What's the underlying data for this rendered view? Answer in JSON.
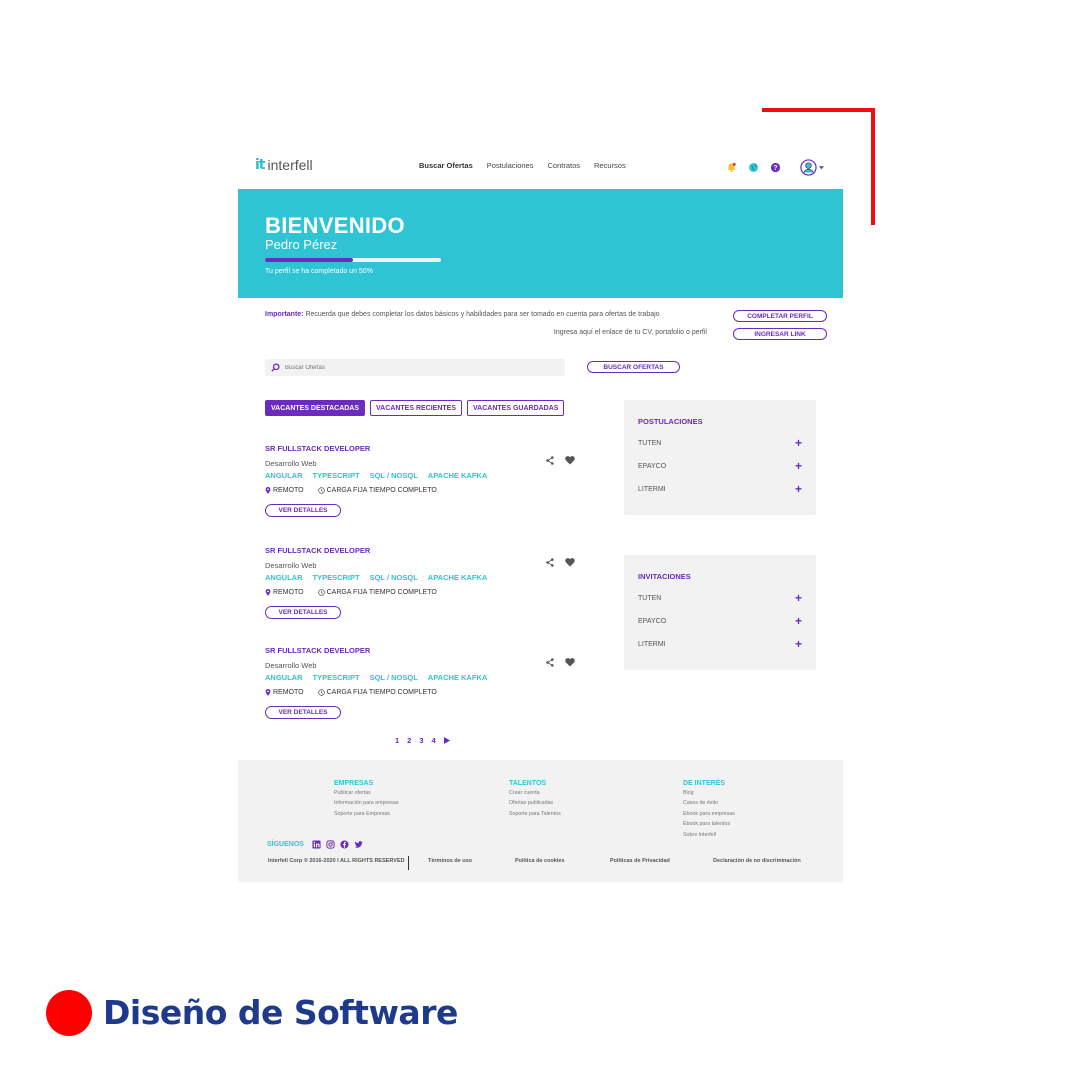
{
  "brand": {
    "logo_mark": "it",
    "logo_text": "interfell"
  },
  "nav": [
    "Buscar Ofertas",
    "Postulaciones",
    "Contratos",
    "Recursos"
  ],
  "header_icons": [
    "bell-icon",
    "globe-icon",
    "help-icon",
    "user-avatar-icon"
  ],
  "banner": {
    "title": "BIENVENIDO",
    "user_name": "Pedro Pérez",
    "progress": 0.5,
    "progress_text": "Tu perfil se ha completado un 50%"
  },
  "notice": {
    "label": "Importante:",
    "text": " Recuerda que debes completar los datos básicos y habilidades para ser tomado en cuenta para ofertas de trabajo",
    "cv_text": "Ingresa aquí el enlace de tu CV, portafolio o perfil",
    "complete_btn": "COMPLETAR PERFIL",
    "link_btn": "INGRESAR LINK"
  },
  "search": {
    "placeholder": "Buscar Ofertas",
    "button": "BUSCAR OFERTAS"
  },
  "tabs": [
    "VACANTES DESTACADAS",
    "VACANTES RECIENTES",
    "VACANTES GUARDADAS"
  ],
  "jobs": [
    {
      "title": "SR FULLSTACK DEVELOPER",
      "category": "Desarrollo Web",
      "tags": [
        "ANGULAR",
        "TYPESCRIPT",
        "SQL / NOSQL",
        "APACHE KAFKA"
      ],
      "location": "REMOTO",
      "schedule": "CARGA FIJA TIEMPO COMPLETO",
      "details_btn": "VER DETALLES"
    },
    {
      "title": "SR FULLSTACK DEVELOPER",
      "category": "Desarrollo Web",
      "tags": [
        "ANGULAR",
        "TYPESCRIPT",
        "SQL / NOSQL",
        "APACHE KAFKA"
      ],
      "location": "REMOTO",
      "schedule": "CARGA FIJA TIEMPO COMPLETO",
      "details_btn": "VER DETALLES"
    },
    {
      "title": "SR FULLSTACK DEVELOPER",
      "category": "Desarrollo Web",
      "tags": [
        "ANGULAR",
        "TYPESCRIPT",
        "SQL / NOSQL",
        "APACHE KAFKA"
      ],
      "location": "REMOTO",
      "schedule": "CARGA FIJA TIEMPO COMPLETO",
      "details_btn": "VER DETALLES"
    }
  ],
  "postulaciones": {
    "title": "POSTULACIONES",
    "items": [
      "TUTEN",
      "EPAYCO",
      "LITERMI"
    ]
  },
  "invitaciones": {
    "title": "INVITACIONES",
    "items": [
      "TUTEN",
      "EPAYCO",
      "LITERMI"
    ]
  },
  "pagination": {
    "pages": [
      "1",
      "2",
      "3",
      "4"
    ],
    "next_icon": "triangle-right-icon"
  },
  "footer": {
    "columns": [
      {
        "title": "EMPRESAS",
        "links": [
          "Publicar ofertas",
          "Información para empresas",
          "Soporte para Empresas"
        ]
      },
      {
        "title": "TALENTOS",
        "links": [
          "Crear cuenta",
          "Ofertas publicadas",
          "Soporte para Talentos"
        ]
      },
      {
        "title": "DE INTERÉS",
        "links": [
          "Blog",
          "Casos de éxito",
          "Ebook para empresas",
          "Ebook para talentos",
          "Sobre Interfell"
        ]
      }
    ],
    "social_label": "SÍGUENOS",
    "social_icons": [
      "linkedin-icon",
      "instagram-icon",
      "facebook-icon",
      "twitter-icon"
    ],
    "copyright": "Interfell Corp ® 2016-2020 I ALL RIGHTS RESERVED",
    "legal": [
      "Términos de uso",
      "Política de cookies",
      "Políticas de Privacidad",
      "Declaración de no discriminación"
    ]
  },
  "caption": "Diseño de Software",
  "colors": {
    "primary": "#6b2bc0",
    "accent": "#2ec4d4",
    "frame": "#f20d0d",
    "caption": "#1e3a8a"
  }
}
